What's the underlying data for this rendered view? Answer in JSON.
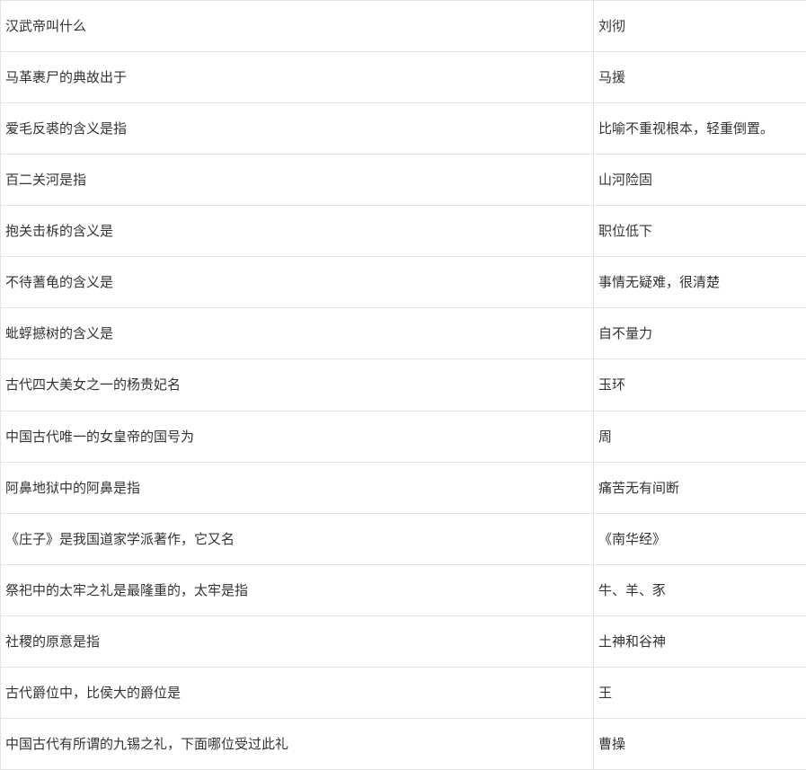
{
  "table": {
    "rows": [
      {
        "question": "汉武帝叫什么",
        "answer": "刘彻"
      },
      {
        "question": "马革裹尸的典故出于",
        "answer": "马援"
      },
      {
        "question": "爱毛反裘的含义是指",
        "answer": "比喻不重视根本，轻重倒置。"
      },
      {
        "question": "百二关河是指",
        "answer": "山河险固"
      },
      {
        "question": "抱关击柝的含义是",
        "answer": "职位低下"
      },
      {
        "question": "不待蓍龟的含义是",
        "answer": "事情无疑难，很清楚"
      },
      {
        "question": "蚍蜉撼树的含义是",
        "answer": "自不量力"
      },
      {
        "question": "古代四大美女之一的杨贵妃名",
        "answer": "玉环"
      },
      {
        "question": "中国古代唯一的女皇帝的国号为",
        "answer": "周"
      },
      {
        "question": "阿鼻地狱中的阿鼻是指",
        "answer": "痛苦无有间断"
      },
      {
        "question": "《庄子》是我国道家学派著作，它又名",
        "answer": "《南华经》"
      },
      {
        "question": "祭祀中的太牢之礼是最隆重的，太牢是指",
        "answer": "牛、羊、豕"
      },
      {
        "question": "社稷的原意是指",
        "answer": "土神和谷神"
      },
      {
        "question": "古代爵位中，比侯大的爵位是",
        "answer": "王"
      },
      {
        "question": "中国古代有所谓的九锡之礼，下面哪位受过此礼",
        "answer": "曹操"
      }
    ]
  }
}
